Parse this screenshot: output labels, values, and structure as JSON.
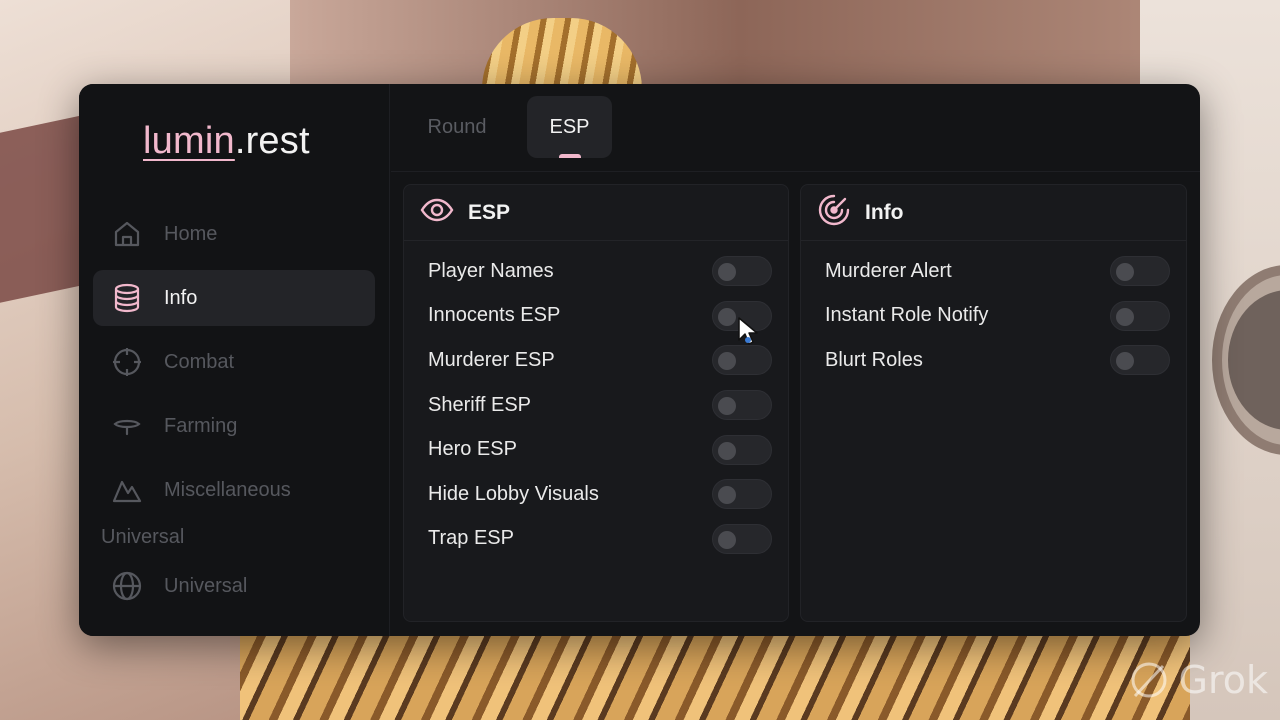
{
  "app": {
    "logo_accent": "lumin",
    "logo_rest": ".rest"
  },
  "sidebar": {
    "items": [
      {
        "label": "Home",
        "icon": "home-icon",
        "active": false
      },
      {
        "label": "Info",
        "icon": "database-icon",
        "active": true
      },
      {
        "label": "Combat",
        "icon": "crosshair-icon",
        "active": false
      },
      {
        "label": "Farming",
        "icon": "farming-icon",
        "active": false
      },
      {
        "label": "Miscellaneous",
        "icon": "mountain-icon",
        "active": false
      }
    ],
    "section_label": "Universal",
    "universal_item": {
      "label": "Universal",
      "icon": "globe-icon",
      "active": false
    }
  },
  "tabs": [
    {
      "label": "Round",
      "active": false
    },
    {
      "label": "ESP",
      "active": true
    }
  ],
  "cards": {
    "esp": {
      "title": "ESP",
      "icon": "eye-icon",
      "rows": [
        {
          "label": "Player Names",
          "enabled": false
        },
        {
          "label": "Innocents ESP",
          "enabled": false
        },
        {
          "label": "Murderer ESP",
          "enabled": false
        },
        {
          "label": "Sheriff ESP",
          "enabled": false
        },
        {
          "label": "Hero ESP",
          "enabled": false
        },
        {
          "label": "Hide Lobby Visuals",
          "enabled": false
        },
        {
          "label": "Trap ESP",
          "enabled": false
        }
      ]
    },
    "info": {
      "title": "Info",
      "icon": "radar-icon",
      "rows": [
        {
          "label": "Murderer Alert",
          "enabled": false
        },
        {
          "label": "Instant Role Notify",
          "enabled": false
        },
        {
          "label": "Blurt Roles",
          "enabled": false
        }
      ]
    }
  },
  "watermark": {
    "text": "Grok",
    "icon": "grok-icon"
  },
  "colors": {
    "accent": "#f1b8cc",
    "panel_bg": "#131416",
    "card_bg": "#18191c",
    "text_active": "#f2f2f2",
    "text_muted": "#56585e"
  }
}
